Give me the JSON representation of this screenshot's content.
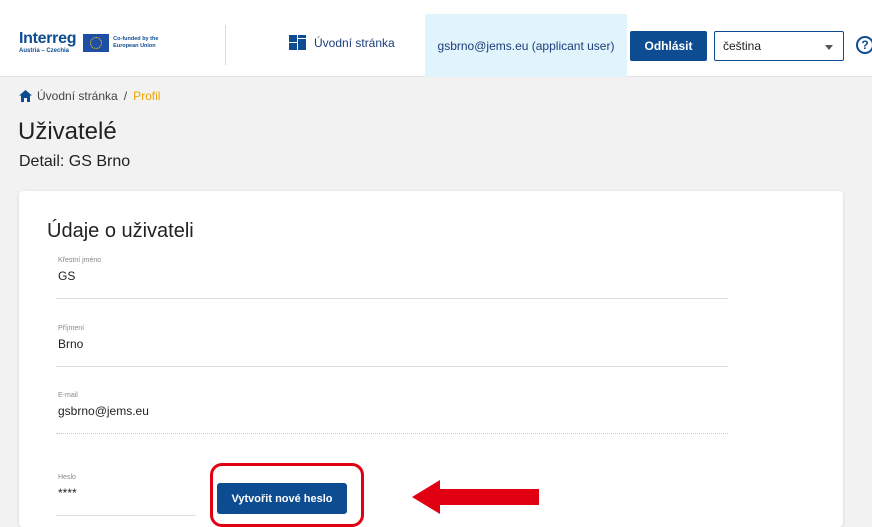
{
  "header": {
    "logo_word": "Interreg",
    "logo_sub": "Austria – Czechia",
    "eu_line1": "Co-funded by the",
    "eu_line2": "European Union",
    "home_link": "Úvodní stránka",
    "user_tab": "gsbrno@jems.eu (applicant user)",
    "logout_label": "Odhlásit",
    "language_value": "čeština",
    "help_glyph": "?"
  },
  "breadcrumb": {
    "home": "Úvodní stránka",
    "separator": "/",
    "current": "Profil"
  },
  "page": {
    "title": "Uživatelé",
    "subtitle": "Detail: GS Brno"
  },
  "card": {
    "title": "Údaje o uživateli",
    "fields": [
      {
        "label": "Křestní jméno",
        "value": "GS"
      },
      {
        "label": "Příjmení",
        "value": "Brno"
      },
      {
        "label": "E-mail",
        "value": "gsbrno@jems.eu"
      },
      {
        "label": "Heslo",
        "value": "****"
      }
    ],
    "new_password_button": "Vytvořit nové heslo"
  },
  "colors": {
    "brand": "#0e4c92",
    "active_tab": "#e2f4fb",
    "breadcrumb_current": "#f0a400",
    "annotation_red": "#e00012"
  },
  "icons": {
    "home": "home-icon",
    "dashboard": "dashboard-grid-icon",
    "help": "help-circle-icon",
    "dropdown": "chevron-down-icon"
  }
}
